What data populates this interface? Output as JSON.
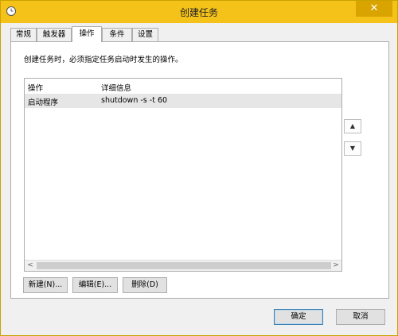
{
  "window": {
    "title": "创建任务",
    "close_glyph": "✕",
    "icon": "clock-icon"
  },
  "tabs": [
    {
      "label": "常规",
      "active": false
    },
    {
      "label": "触发器",
      "active": false
    },
    {
      "label": "操作",
      "active": true
    },
    {
      "label": "条件",
      "active": false
    },
    {
      "label": "设置",
      "active": false
    }
  ],
  "instruction": "创建任务时，必须指定任务启动时发生的操作。",
  "actions_table": {
    "columns": [
      "操作",
      "详细信息"
    ],
    "rows": [
      {
        "action": "启动程序",
        "details": "shutdown -s -t 60"
      }
    ]
  },
  "side_buttons": {
    "move_up_glyph": "▲",
    "move_down_glyph": "▼"
  },
  "scrollbar": {
    "left_glyph": "<",
    "right_glyph": ">"
  },
  "action_buttons": {
    "new_label": "新建(N)...",
    "edit_label": "编辑(E)...",
    "delete_label": "删除(D)"
  },
  "dialog_buttons": {
    "ok_label": "确定",
    "cancel_label": "取消"
  },
  "colors": {
    "titlebar": "#f5c21a",
    "selection_row": "#e6e6e6",
    "default_button_border": "#3c7fb1"
  }
}
